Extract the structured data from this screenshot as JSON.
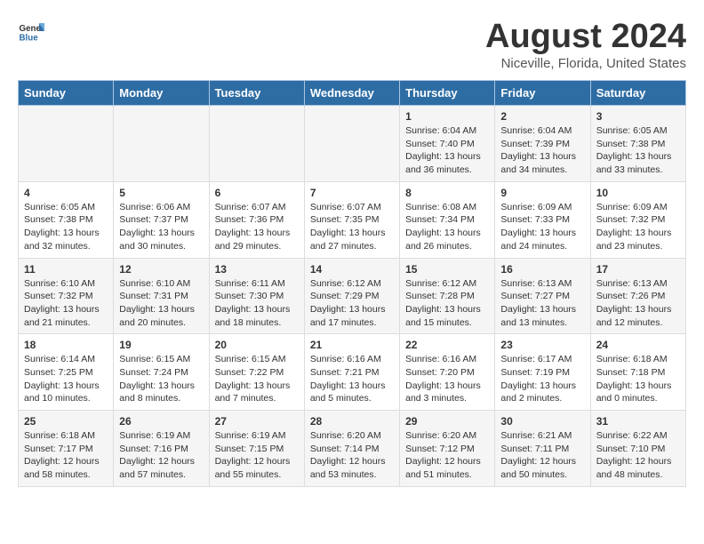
{
  "header": {
    "logo_general": "General",
    "logo_blue": "Blue",
    "month_title": "August 2024",
    "location": "Niceville, Florida, United States"
  },
  "weekdays": [
    "Sunday",
    "Monday",
    "Tuesday",
    "Wednesday",
    "Thursday",
    "Friday",
    "Saturday"
  ],
  "weeks": [
    [
      {
        "day": "",
        "info": ""
      },
      {
        "day": "",
        "info": ""
      },
      {
        "day": "",
        "info": ""
      },
      {
        "day": "",
        "info": ""
      },
      {
        "day": "1",
        "info": "Sunrise: 6:04 AM\nSunset: 7:40 PM\nDaylight: 13 hours\nand 36 minutes."
      },
      {
        "day": "2",
        "info": "Sunrise: 6:04 AM\nSunset: 7:39 PM\nDaylight: 13 hours\nand 34 minutes."
      },
      {
        "day": "3",
        "info": "Sunrise: 6:05 AM\nSunset: 7:38 PM\nDaylight: 13 hours\nand 33 minutes."
      }
    ],
    [
      {
        "day": "4",
        "info": "Sunrise: 6:05 AM\nSunset: 7:38 PM\nDaylight: 13 hours\nand 32 minutes."
      },
      {
        "day": "5",
        "info": "Sunrise: 6:06 AM\nSunset: 7:37 PM\nDaylight: 13 hours\nand 30 minutes."
      },
      {
        "day": "6",
        "info": "Sunrise: 6:07 AM\nSunset: 7:36 PM\nDaylight: 13 hours\nand 29 minutes."
      },
      {
        "day": "7",
        "info": "Sunrise: 6:07 AM\nSunset: 7:35 PM\nDaylight: 13 hours\nand 27 minutes."
      },
      {
        "day": "8",
        "info": "Sunrise: 6:08 AM\nSunset: 7:34 PM\nDaylight: 13 hours\nand 26 minutes."
      },
      {
        "day": "9",
        "info": "Sunrise: 6:09 AM\nSunset: 7:33 PM\nDaylight: 13 hours\nand 24 minutes."
      },
      {
        "day": "10",
        "info": "Sunrise: 6:09 AM\nSunset: 7:32 PM\nDaylight: 13 hours\nand 23 minutes."
      }
    ],
    [
      {
        "day": "11",
        "info": "Sunrise: 6:10 AM\nSunset: 7:32 PM\nDaylight: 13 hours\nand 21 minutes."
      },
      {
        "day": "12",
        "info": "Sunrise: 6:10 AM\nSunset: 7:31 PM\nDaylight: 13 hours\nand 20 minutes."
      },
      {
        "day": "13",
        "info": "Sunrise: 6:11 AM\nSunset: 7:30 PM\nDaylight: 13 hours\nand 18 minutes."
      },
      {
        "day": "14",
        "info": "Sunrise: 6:12 AM\nSunset: 7:29 PM\nDaylight: 13 hours\nand 17 minutes."
      },
      {
        "day": "15",
        "info": "Sunrise: 6:12 AM\nSunset: 7:28 PM\nDaylight: 13 hours\nand 15 minutes."
      },
      {
        "day": "16",
        "info": "Sunrise: 6:13 AM\nSunset: 7:27 PM\nDaylight: 13 hours\nand 13 minutes."
      },
      {
        "day": "17",
        "info": "Sunrise: 6:13 AM\nSunset: 7:26 PM\nDaylight: 13 hours\nand 12 minutes."
      }
    ],
    [
      {
        "day": "18",
        "info": "Sunrise: 6:14 AM\nSunset: 7:25 PM\nDaylight: 13 hours\nand 10 minutes."
      },
      {
        "day": "19",
        "info": "Sunrise: 6:15 AM\nSunset: 7:24 PM\nDaylight: 13 hours\nand 8 minutes."
      },
      {
        "day": "20",
        "info": "Sunrise: 6:15 AM\nSunset: 7:22 PM\nDaylight: 13 hours\nand 7 minutes."
      },
      {
        "day": "21",
        "info": "Sunrise: 6:16 AM\nSunset: 7:21 PM\nDaylight: 13 hours\nand 5 minutes."
      },
      {
        "day": "22",
        "info": "Sunrise: 6:16 AM\nSunset: 7:20 PM\nDaylight: 13 hours\nand 3 minutes."
      },
      {
        "day": "23",
        "info": "Sunrise: 6:17 AM\nSunset: 7:19 PM\nDaylight: 13 hours\nand 2 minutes."
      },
      {
        "day": "24",
        "info": "Sunrise: 6:18 AM\nSunset: 7:18 PM\nDaylight: 13 hours\nand 0 minutes."
      }
    ],
    [
      {
        "day": "25",
        "info": "Sunrise: 6:18 AM\nSunset: 7:17 PM\nDaylight: 12 hours\nand 58 minutes."
      },
      {
        "day": "26",
        "info": "Sunrise: 6:19 AM\nSunset: 7:16 PM\nDaylight: 12 hours\nand 57 minutes."
      },
      {
        "day": "27",
        "info": "Sunrise: 6:19 AM\nSunset: 7:15 PM\nDaylight: 12 hours\nand 55 minutes."
      },
      {
        "day": "28",
        "info": "Sunrise: 6:20 AM\nSunset: 7:14 PM\nDaylight: 12 hours\nand 53 minutes."
      },
      {
        "day": "29",
        "info": "Sunrise: 6:20 AM\nSunset: 7:12 PM\nDaylight: 12 hours\nand 51 minutes."
      },
      {
        "day": "30",
        "info": "Sunrise: 6:21 AM\nSunset: 7:11 PM\nDaylight: 12 hours\nand 50 minutes."
      },
      {
        "day": "31",
        "info": "Sunrise: 6:22 AM\nSunset: 7:10 PM\nDaylight: 12 hours\nand 48 minutes."
      }
    ]
  ]
}
